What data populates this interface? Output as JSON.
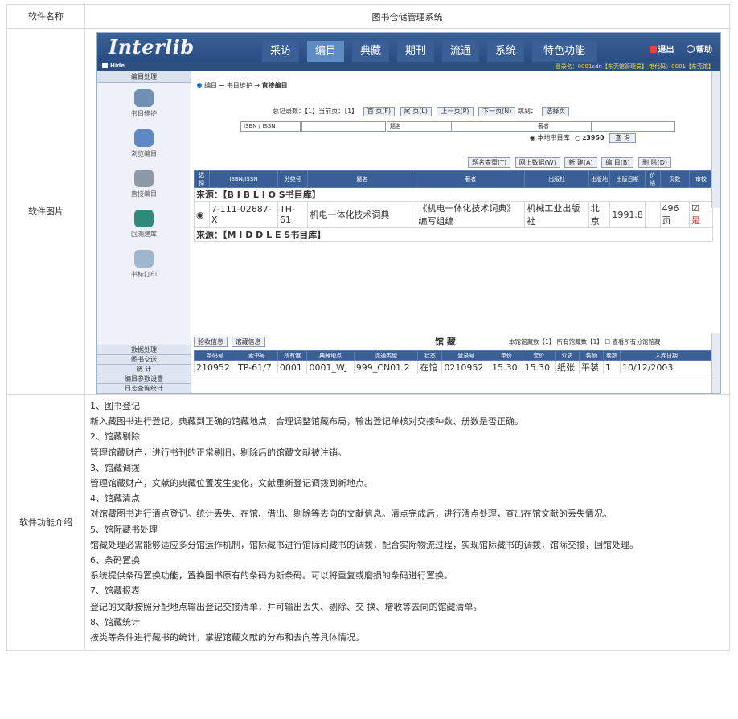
{
  "spec": {
    "name_label": "软件名称",
    "name_value": "图书仓储管理系统",
    "image_label": "软件图片",
    "features_label": "软件功能介绍",
    "features": [
      {
        "title": "1、图书登记",
        "text": "新入藏图书进行登记，典藏到正确的馆藏地点，合理调整馆藏布局，输出登记单核对交接种数、册数是否正确。"
      },
      {
        "title": "2、馆藏剔除",
        "text": "管理馆藏财产，进行书刊的正常剔旧，剔除后的馆藏文献被注销。"
      },
      {
        "title": "3、馆藏调拨",
        "text": "管理馆藏财产，文献的典藏位置发生变化，文献重新登记调拨到新地点。"
      },
      {
        "title": "4、馆藏清点",
        "text": "对馆藏图书进行清点登记。统计丢失、在馆、借出、剔除等去向的文献信息。清点完成后，进行清点处理，查出在馆文献的丢失情况。"
      },
      {
        "title": "5、馆际藏书处理",
        "text": "馆藏处理必需能够适应多分馆运作机制，馆际藏书进行馆际间藏书的调拨，配合实际物流过程，实现馆际藏书的调拨，馆际交接，回馆处理。"
      },
      {
        "title": "6、条码置换",
        "text": "系统提供条码置换功能，置换图书原有的条码为新条码。可以将重复或磨损的条码进行置换。"
      },
      {
        "title": "7、馆藏报表",
        "text": "登记的文献按照分配地点输出登记交接清单，并可输出丢失、剔除、交 换、增收等去向的馆藏清单。"
      },
      {
        "title": "8、馆藏统计",
        "text": "按类等条件进行藏书的统计，掌握馆藏文献的分布和去向等具体情况。"
      }
    ]
  },
  "app": {
    "logo": "Interlib",
    "nav": [
      "采访",
      "编目",
      "典藏",
      "期刊",
      "流通",
      "系统",
      "特色功能"
    ],
    "active_nav": "编目",
    "quick": {
      "logout": "退出",
      "help": "帮助"
    },
    "hide": "Hide",
    "login_info": "登录名：0001sdn【东莞馆管理员】   馆代码：0001【东莞馆】",
    "left": {
      "header": "编目处理",
      "items": [
        "书目维护",
        "浏览编目",
        "直接编目",
        "回溯建库",
        "书标打印"
      ],
      "footer": [
        "数据处理",
        "图书交送",
        "统 计",
        "编目参数设置",
        "日志查询统计"
      ]
    },
    "breadcrumb": {
      "a": "编目",
      "b": "书目维护",
      "c": "直接编目"
    },
    "pager": {
      "summary": "总记录数：【1】当前页：【1】",
      "first": "首 页(F)",
      "last": "尾 页(L)",
      "prev": "上一页(P)",
      "next": "下一页(N)",
      "goto": "跳到：",
      "select": "选择页"
    },
    "search": {
      "f1": "ISBN / ISSN",
      "f2": "题名",
      "f3": "著者",
      "r1": "本地书目库",
      "r2": "z3950",
      "query": "查 询"
    },
    "actions": [
      "题名查重(T)",
      "网上数据(W)",
      "新 建(A)",
      "编 目(B)",
      "删 除(D)"
    ],
    "grid_headers": [
      "选择",
      "ISBN/ISSN",
      "分类号",
      "题名",
      "著者",
      "出版社",
      "出版地",
      "出版日期",
      "价格",
      "页数",
      "审校"
    ],
    "source1": "来源：【B I B L I O S书目库】",
    "row": [
      "7-111-02687-X",
      "TH-61",
      "机电一体化技术词典",
      "《机电一体化技术词典》编写组编",
      "机械工业出版社",
      "北京",
      "1991.8",
      "",
      "496页",
      "是"
    ],
    "source2": "来源：【M I D D L E S书目库】",
    "lower": {
      "tabs": [
        "验收信息",
        "馆藏信息"
      ],
      "title": "馆 藏",
      "count": "本馆馆藏数【1】 所有馆藏数【1】",
      "check": "查看所有分馆馆藏",
      "headers": [
        "条码号",
        "索书号",
        "所有馆",
        "典藏地点",
        "流通类型",
        "状态",
        "登录号",
        "单价",
        "套价",
        "介质",
        "装帧",
        "卷数",
        "入库日期"
      ],
      "row": [
        "210952",
        "TP-61/7",
        "0001",
        "0001_WJ",
        "999_CN01 2",
        "在馆",
        "0210952",
        "15.30",
        "15.30",
        "纸张",
        "平装",
        "1",
        "10/12/2003"
      ]
    },
    "colors": {
      "nav_bg": "#2d507f",
      "header_bg": "#3a5e96"
    }
  }
}
